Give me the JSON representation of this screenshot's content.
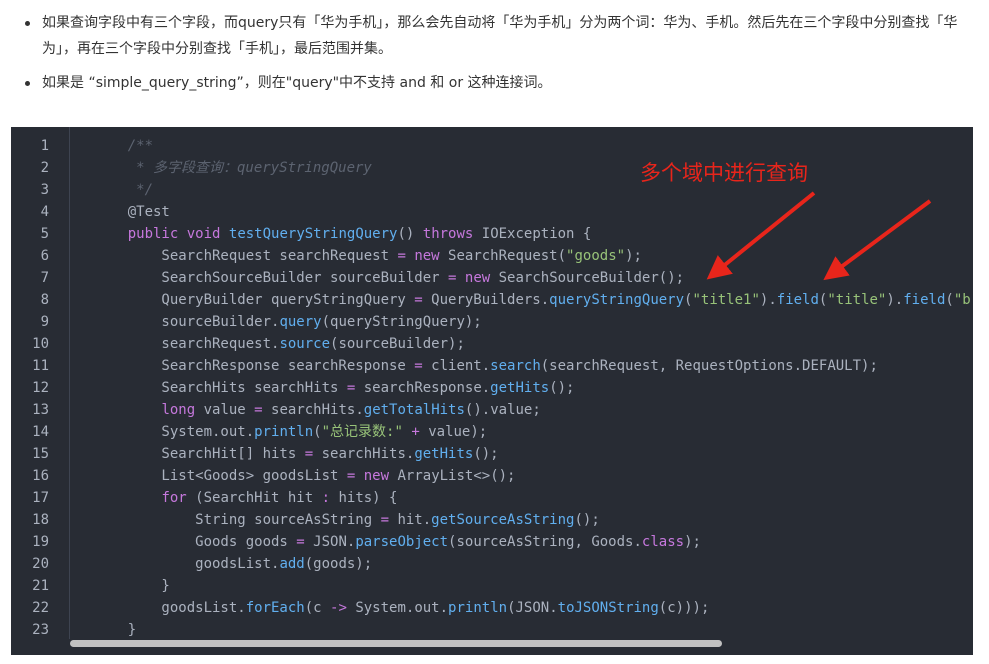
{
  "bullets": [
    "如果查询字段中有三个字段，而query只有「华为手机」，那么会先自动将「华为手机」分为两个词：华为、手机。然后先在三个字段中分别查找「华为」，再在三个字段中分别查找「手机」，最后范围并集。",
    "如果是 “simple_query_string”，则在\"query\"中不支持 and 和 or 这种连接词。"
  ],
  "annotation": "多个域中进行查询",
  "code": {
    "language": "java",
    "lines": [
      {
        "n": "1",
        "tokens": [
          {
            "t": "    /**",
            "c": "comment"
          }
        ]
      },
      {
        "n": "2",
        "tokens": [
          {
            "t": "     * 多字段查询：queryStringQuery",
            "c": "comment"
          }
        ]
      },
      {
        "n": "3",
        "tokens": [
          {
            "t": "     */",
            "c": "comment"
          }
        ]
      },
      {
        "n": "4",
        "tokens": [
          {
            "t": "    @Test",
            "c": "plain"
          }
        ]
      },
      {
        "n": "5",
        "tokens": [
          {
            "t": "    ",
            "c": "plain"
          },
          {
            "t": "public",
            "c": "kw"
          },
          {
            "t": " ",
            "c": "plain"
          },
          {
            "t": "void",
            "c": "kw"
          },
          {
            "t": " ",
            "c": "plain"
          },
          {
            "t": "testQueryStringQuery",
            "c": "fn"
          },
          {
            "t": "() ",
            "c": "plain"
          },
          {
            "t": "throws",
            "c": "kw"
          },
          {
            "t": " IOException {",
            "c": "plain"
          }
        ]
      },
      {
        "n": "6",
        "tokens": [
          {
            "t": "        SearchRequest searchRequest ",
            "c": "plain"
          },
          {
            "t": "=",
            "c": "kw"
          },
          {
            "t": " ",
            "c": "plain"
          },
          {
            "t": "new",
            "c": "kw"
          },
          {
            "t": " SearchRequest(",
            "c": "plain"
          },
          {
            "t": "\"goods\"",
            "c": "str"
          },
          {
            "t": ");",
            "c": "plain"
          }
        ]
      },
      {
        "n": "7",
        "tokens": [
          {
            "t": "        SearchSourceBuilder sourceBuilder ",
            "c": "plain"
          },
          {
            "t": "=",
            "c": "kw"
          },
          {
            "t": " ",
            "c": "plain"
          },
          {
            "t": "new",
            "c": "kw"
          },
          {
            "t": " SearchSourceBuilder();",
            "c": "plain"
          }
        ]
      },
      {
        "n": "8",
        "tokens": [
          {
            "t": "        QueryBuilder queryStringQuery ",
            "c": "plain"
          },
          {
            "t": "=",
            "c": "kw"
          },
          {
            "t": " QueryBuilders.",
            "c": "plain"
          },
          {
            "t": "queryStringQuery",
            "c": "fn"
          },
          {
            "t": "(",
            "c": "plain"
          },
          {
            "t": "\"title1\"",
            "c": "str"
          },
          {
            "t": ").",
            "c": "plain"
          },
          {
            "t": "field",
            "c": "fn"
          },
          {
            "t": "(",
            "c": "plain"
          },
          {
            "t": "\"title\"",
            "c": "str"
          },
          {
            "t": ").",
            "c": "plain"
          },
          {
            "t": "field",
            "c": "fn"
          },
          {
            "t": "(",
            "c": "plain"
          },
          {
            "t": "\"brand\"",
            "c": "str"
          }
        ]
      },
      {
        "n": "9",
        "tokens": [
          {
            "t": "        sourceBuilder.",
            "c": "plain"
          },
          {
            "t": "query",
            "c": "fn"
          },
          {
            "t": "(queryStringQuery);",
            "c": "plain"
          }
        ]
      },
      {
        "n": "10",
        "tokens": [
          {
            "t": "        searchRequest.",
            "c": "plain"
          },
          {
            "t": "source",
            "c": "fn"
          },
          {
            "t": "(sourceBuilder);",
            "c": "plain"
          }
        ]
      },
      {
        "n": "11",
        "tokens": [
          {
            "t": "        SearchResponse searchResponse ",
            "c": "plain"
          },
          {
            "t": "=",
            "c": "kw"
          },
          {
            "t": " client.",
            "c": "plain"
          },
          {
            "t": "search",
            "c": "fn"
          },
          {
            "t": "(searchRequest, RequestOptions.DEFAULT);",
            "c": "plain"
          }
        ]
      },
      {
        "n": "12",
        "tokens": [
          {
            "t": "        SearchHits searchHits ",
            "c": "plain"
          },
          {
            "t": "=",
            "c": "kw"
          },
          {
            "t": " searchResponse.",
            "c": "plain"
          },
          {
            "t": "getHits",
            "c": "fn"
          },
          {
            "t": "();",
            "c": "plain"
          }
        ]
      },
      {
        "n": "13",
        "tokens": [
          {
            "t": "        ",
            "c": "plain"
          },
          {
            "t": "long",
            "c": "kw"
          },
          {
            "t": " value ",
            "c": "plain"
          },
          {
            "t": "=",
            "c": "kw"
          },
          {
            "t": " searchHits.",
            "c": "plain"
          },
          {
            "t": "getTotalHits",
            "c": "fn"
          },
          {
            "t": "().value;",
            "c": "plain"
          }
        ]
      },
      {
        "n": "14",
        "tokens": [
          {
            "t": "        System.out.",
            "c": "plain"
          },
          {
            "t": "println",
            "c": "fn"
          },
          {
            "t": "(",
            "c": "plain"
          },
          {
            "t": "\"总记录数:\"",
            "c": "str"
          },
          {
            "t": " ",
            "c": "plain"
          },
          {
            "t": "+",
            "c": "kw"
          },
          {
            "t": " value);",
            "c": "plain"
          }
        ]
      },
      {
        "n": "15",
        "tokens": [
          {
            "t": "        SearchHit[] hits ",
            "c": "plain"
          },
          {
            "t": "=",
            "c": "kw"
          },
          {
            "t": " searchHits.",
            "c": "plain"
          },
          {
            "t": "getHits",
            "c": "fn"
          },
          {
            "t": "();",
            "c": "plain"
          }
        ]
      },
      {
        "n": "16",
        "tokens": [
          {
            "t": "        List<Goods> goodsList ",
            "c": "plain"
          },
          {
            "t": "=",
            "c": "kw"
          },
          {
            "t": " ",
            "c": "plain"
          },
          {
            "t": "new",
            "c": "kw"
          },
          {
            "t": " ArrayList<>();",
            "c": "plain"
          }
        ]
      },
      {
        "n": "17",
        "tokens": [
          {
            "t": "        ",
            "c": "plain"
          },
          {
            "t": "for",
            "c": "kw"
          },
          {
            "t": " (SearchHit hit ",
            "c": "plain"
          },
          {
            "t": ":",
            "c": "kw"
          },
          {
            "t": " hits) {",
            "c": "plain"
          }
        ]
      },
      {
        "n": "18",
        "tokens": [
          {
            "t": "            String sourceAsString ",
            "c": "plain"
          },
          {
            "t": "=",
            "c": "kw"
          },
          {
            "t": " hit.",
            "c": "plain"
          },
          {
            "t": "getSourceAsString",
            "c": "fn"
          },
          {
            "t": "();",
            "c": "plain"
          }
        ]
      },
      {
        "n": "19",
        "tokens": [
          {
            "t": "            Goods goods ",
            "c": "plain"
          },
          {
            "t": "=",
            "c": "kw"
          },
          {
            "t": " JSON.",
            "c": "plain"
          },
          {
            "t": "parseObject",
            "c": "fn"
          },
          {
            "t": "(sourceAsString, Goods.",
            "c": "plain"
          },
          {
            "t": "class",
            "c": "kw"
          },
          {
            "t": ");",
            "c": "plain"
          }
        ]
      },
      {
        "n": "20",
        "tokens": [
          {
            "t": "            goodsList.",
            "c": "plain"
          },
          {
            "t": "add",
            "c": "fn"
          },
          {
            "t": "(goods);",
            "c": "plain"
          }
        ]
      },
      {
        "n": "21",
        "tokens": [
          {
            "t": "        }",
            "c": "plain"
          }
        ]
      },
      {
        "n": "22",
        "tokens": [
          {
            "t": "        goodsList.",
            "c": "plain"
          },
          {
            "t": "forEach",
            "c": "fn"
          },
          {
            "t": "(c ",
            "c": "plain"
          },
          {
            "t": "->",
            "c": "kw"
          },
          {
            "t": " System.out.",
            "c": "plain"
          },
          {
            "t": "println",
            "c": "fn"
          },
          {
            "t": "(JSON.",
            "c": "plain"
          },
          {
            "t": "toJSONString",
            "c": "fn"
          },
          {
            "t": "(c)));",
            "c": "plain"
          }
        ]
      },
      {
        "n": "23",
        "tokens": [
          {
            "t": "    }",
            "c": "plain"
          }
        ]
      }
    ]
  },
  "colors": {
    "code_background": "#282c34",
    "comment": "#5c6370",
    "keyword": "#c678dd",
    "function": "#61afef",
    "string": "#98c379",
    "plain": "#abb2bf",
    "annotation": "#e8251b"
  },
  "icons": [
    "arrow-icon",
    "arrow-icon"
  ]
}
